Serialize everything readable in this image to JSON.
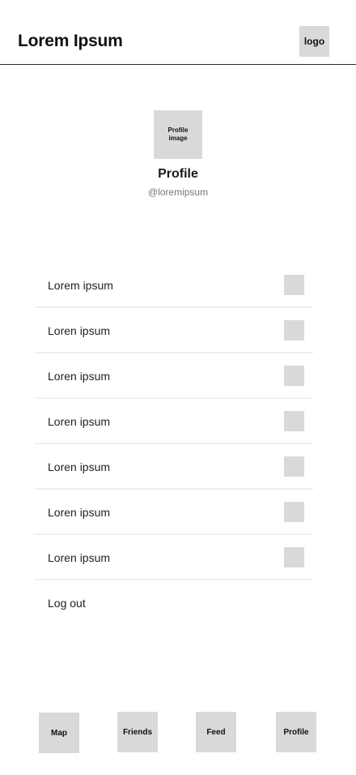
{
  "header": {
    "title": "Lorem Ipsum",
    "logo_label": "logo"
  },
  "profile": {
    "image_label_line1": "Profile",
    "image_label_line2": "image",
    "name": "Profile",
    "handle": "@loremipsum"
  },
  "settings": {
    "items": [
      {
        "label": "Lorem ipsum"
      },
      {
        "label": "Loren ipsum"
      },
      {
        "label": "Loren ipsum"
      },
      {
        "label": "Loren ipsum"
      },
      {
        "label": "Loren ipsum"
      },
      {
        "label": "Loren ipsum"
      },
      {
        "label": "Loren ipsum"
      }
    ],
    "logout_label": "Log out"
  },
  "nav": {
    "map": "Map",
    "friends": "Friends",
    "feed": "Feed",
    "profile": "Profile"
  },
  "colors": {
    "placeholder": "#d9d9d9",
    "divider": "#efefef",
    "handle_text": "#777777"
  }
}
